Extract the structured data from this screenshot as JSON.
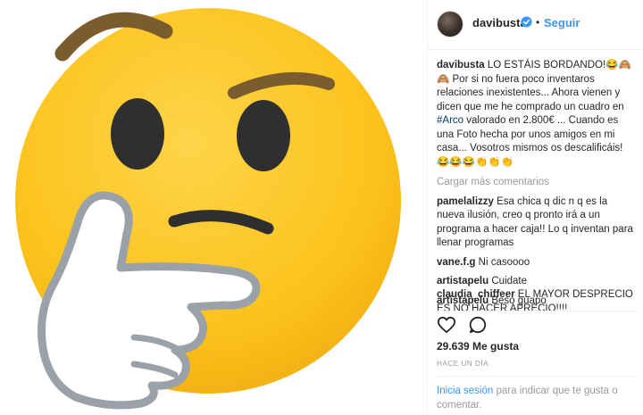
{
  "post": {
    "username": "davibusta",
    "dot": "•",
    "follow_label": "Seguir"
  },
  "caption": {
    "user": "davibusta",
    "text_1": " LO ESTÁIS BORDANDO!😂🙈🙈 Por si no fuera poco inventaros relaciones inexistentes... Ahora vienen y dicen que me he comprado un cuadro en ",
    "hashtag": "#Arco",
    "text_2": " valorado en 2.800€ ... Cuando es una Foto hecha por unos amigos en mi casa... Vosotros mismos os descalificáis! 😂😂😂👏👏👏"
  },
  "load_more_label": "Cargar más comentarios",
  "comments": [
    {
      "user": "pamelalizzy",
      "text": " Esa chica q dic n q es la nueva ilusión, creo q pronto irá a un programa a hacer caja!! Lo q inventan para llenar programas"
    },
    {
      "user": "vane.f.g",
      "text": " Ni casoooo"
    },
    {
      "user": "artistapelu",
      "text": " Cuidate"
    },
    {
      "user": "artistapelu",
      "text": " Beso guapo"
    },
    {
      "user": "claudia_chiffeer",
      "text": " EL MAYOR DESPRECIO ES NO HACER APRECIO!!!!"
    }
  ],
  "likes": "29.639 Me gusta",
  "timestamp": "HACE UN DÍA",
  "login": {
    "link": "Inicia sesión",
    "text": " para indicar que te gusta o comentar."
  },
  "colors": {
    "accent": "#3897f0",
    "emoji_yellow": "#fcc21b",
    "text": "#262626",
    "muted": "#999999"
  },
  "icons": [
    "verified-badge-icon",
    "heart-icon",
    "comment-icon"
  ]
}
